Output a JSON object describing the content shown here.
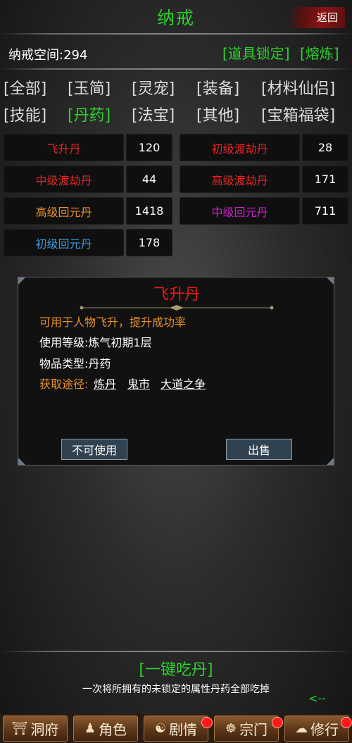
{
  "header": {
    "title": "纳戒",
    "back_label": "返回"
  },
  "storage": {
    "space_label": "纳戒空间:294",
    "lock_label": "[道具锁定]",
    "smelt_label": "[熔炼]"
  },
  "tabs": [
    {
      "label": "[全部]"
    },
    {
      "label": "[玉简]"
    },
    {
      "label": "[灵宠]"
    },
    {
      "label": "[装备]"
    },
    {
      "label": "[材料仙侣]"
    },
    {
      "label": "[技能]"
    },
    {
      "label": "[丹药]"
    },
    {
      "label": "[法宝]"
    },
    {
      "label": "[其他]"
    },
    {
      "label": "[宝箱福袋]"
    }
  ],
  "items": [
    {
      "name": "飞升丹",
      "count": "120",
      "color": "#e52424"
    },
    {
      "name": "初级渡劫丹",
      "count": "28",
      "color": "#e52424"
    },
    {
      "name": "中级渡劫丹",
      "count": "44",
      "color": "#e52424"
    },
    {
      "name": "高级渡劫丹",
      "count": "171",
      "color": "#e52424"
    },
    {
      "name": "高级回元丹",
      "count": "1418",
      "color": "#e8902a"
    },
    {
      "name": "中级回元丹",
      "count": "711",
      "color": "#d21fd2"
    },
    {
      "name": "初级回元丹",
      "count": "178",
      "color": "#3a9ad9"
    }
  ],
  "detail": {
    "name": "飞升丹",
    "desc": "可用于人物飞升，提升成功率",
    "level": "使用等级:炼气初期1层",
    "type": "物品类型:丹药",
    "source_label": "获取途径:",
    "sources": [
      "炼丹",
      "鬼市",
      "大道之争"
    ],
    "use_button": "不可使用",
    "sell_button": "出售"
  },
  "eat": {
    "label": "[一键吃丹]",
    "desc": "一次将所拥有的未锁定的属性丹药全部吃掉",
    "arrow": "<--"
  },
  "nav": [
    {
      "label": "洞府",
      "icon": "⛩",
      "dot": false
    },
    {
      "label": "角色",
      "icon": "♟",
      "dot": false
    },
    {
      "label": "剧情",
      "icon": "☯",
      "dot": true
    },
    {
      "label": "宗门",
      "icon": "☸",
      "dot": true
    },
    {
      "label": "修行",
      "icon": "☁",
      "dot": true
    }
  ]
}
